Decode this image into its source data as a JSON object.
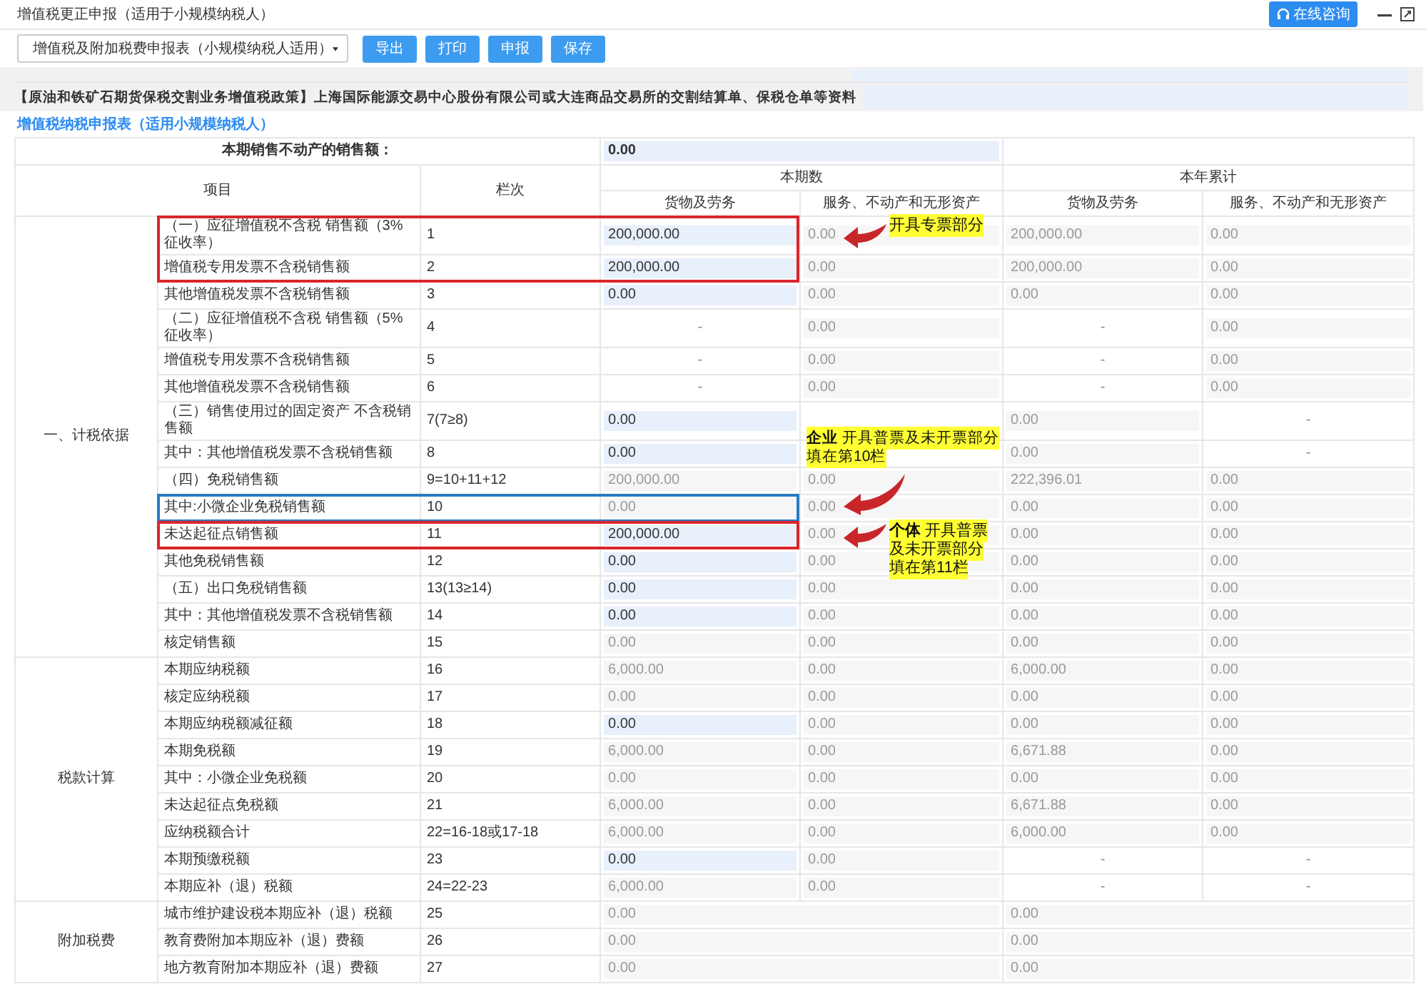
{
  "window": {
    "title": "增值税更正申报（适用于小规模纳税人）",
    "help_button": "在线咨询"
  },
  "toolbar": {
    "report_select": "增值税及附加税费申报表（小规模纳税人适用）",
    "buttons": [
      "导出",
      "打印",
      "申报",
      "保存"
    ]
  },
  "policy_note": "【原油和铁矿石期货保税交割业务增值税政策】上海国际能源交易中心股份有限公司或大连商品交易所的交割结算单、保税仓单等资料",
  "form_title": "增值税纳税申报表（适用小规模纳税人）",
  "table": {
    "real_estate_label": "本期销售不动产的销售额：",
    "real_estate_value": "0.00",
    "headers": {
      "item": "项目",
      "line": "栏次",
      "current": "本期数",
      "year": "本年累计",
      "sub": [
        "货物及劳务",
        "服务、不动产和无形资产",
        "货物及劳务",
        "服务、不动产和无形资产"
      ]
    },
    "groups": [
      {
        "label": "一、计税依据",
        "rows": [
          {
            "item": "（一）应征增值税不含税 销售额（3% 征收率）",
            "line": "1",
            "color": "#d9262c",
            "cells": [
              {
                "kind": "input",
                "value": "200,000.00"
              },
              {
                "kind": "readonly",
                "value": "0.00"
              },
              {
                "kind": "readonly",
                "value": "200,000.00"
              },
              {
                "kind": "readonly",
                "value": "0.00"
              }
            ],
            "note": {
              "kind": "beside",
              "lines": [
                "开具专票部分"
              ]
            }
          },
          {
            "item": "增值税专用发票不含税销售额",
            "line": "2",
            "color": "#d9262c",
            "cells": [
              {
                "kind": "input",
                "value": "200,000.00"
              },
              {
                "kind": "readonly",
                "value": "0.00"
              },
              {
                "kind": "readonly",
                "value": "200,000.00"
              },
              {
                "kind": "readonly",
                "value": "0.00"
              }
            ]
          },
          {
            "item": "其他增值税发票不含税销售额",
            "line": "3",
            "cells": [
              {
                "kind": "input",
                "value": "0.00"
              },
              {
                "kind": "readonly",
                "value": "0.00"
              },
              {
                "kind": "readonly",
                "value": "0.00"
              },
              {
                "kind": "readonly",
                "value": "0.00"
              }
            ]
          },
          {
            "item": "（二）应征增值税不含税 销售额（5%征收率）",
            "line": "4",
            "cells": [
              {
                "kind": "dash",
                "value": "-"
              },
              {
                "kind": "readonly",
                "value": "0.00"
              },
              {
                "kind": "dash",
                "value": "-"
              },
              {
                "kind": "readonly",
                "value": "0.00"
              }
            ]
          },
          {
            "item": "增值税专用发票不含税销售额",
            "line": "5",
            "cells": [
              {
                "kind": "dash",
                "value": "-"
              },
              {
                "kind": "readonly",
                "value": "0.00"
              },
              {
                "kind": "dash",
                "value": "-"
              },
              {
                "kind": "readonly",
                "value": "0.00"
              }
            ]
          },
          {
            "item": "其他增值税发票不含税销售额",
            "line": "6",
            "cells": [
              {
                "kind": "dash",
                "value": "-"
              },
              {
                "kind": "readonly",
                "value": "0.00"
              },
              {
                "kind": "dash",
                "value": "-"
              },
              {
                "kind": "readonly",
                "value": "0.00"
              }
            ]
          },
          {
            "item": "（三）销售使用过的固定资产 不含税销售额",
            "line": "7(7≥8)",
            "cells": [
              {
                "kind": "input",
                "value": "0.00"
              },
              {
                "kind": "blank"
              },
              {
                "kind": "readonly",
                "value": "0.00"
              },
              {
                "kind": "dash",
                "value": "-"
              }
            ]
          },
          {
            "item": "其中：其他增值税发票不含税销售额",
            "line": "8",
            "cells": [
              {
                "kind": "input",
                "value": "0.00"
              },
              {
                "kind": "blank"
              },
              {
                "kind": "readonly",
                "value": "0.00"
              },
              {
                "kind": "dash",
                "value": "-"
              }
            ]
          },
          {
            "item": "（四）免税销售额",
            "line": "9=10+11+12",
            "cells": [
              {
                "kind": "readonly",
                "value": "200,000.00"
              },
              {
                "kind": "readonly",
                "value": "0.00"
              },
              {
                "kind": "readonly",
                "value": "222,396.01"
              },
              {
                "kind": "readonly",
                "value": "0.00"
              }
            ]
          },
          {
            "item": "其中:小微企业免税销售额",
            "line": "10",
            "color": "#2a7bc4",
            "cells": [
              {
                "kind": "readonly",
                "value": "0.00"
              },
              {
                "kind": "readonly",
                "value": "0.00"
              },
              {
                "kind": "readonly",
                "value": "0.00"
              },
              {
                "kind": "readonly",
                "value": "0.00"
              }
            ],
            "note": {
              "kind": "above",
              "lines": [
                "**企业** 开具普票及未开票部分",
                "填在第10栏"
              ]
            }
          },
          {
            "item": "未达起征点销售额",
            "line": "11",
            "color": "#d9262c",
            "cells": [
              {
                "kind": "input",
                "value": "200,000.00"
              },
              {
                "kind": "readonly",
                "value": "0.00"
              },
              {
                "kind": "readonly",
                "value": "0.00"
              },
              {
                "kind": "readonly",
                "value": "0.00"
              }
            ],
            "note": {
              "kind": "beside",
              "lines": [
                "**个体** 开具普票及未开票部分",
                "填在第11栏"
              ]
            }
          },
          {
            "item": "其他免税销售额",
            "line": "12",
            "cells": [
              {
                "kind": "input",
                "value": "0.00"
              },
              {
                "kind": "readonly",
                "value": "0.00"
              },
              {
                "kind": "readonly",
                "value": "0.00"
              },
              {
                "kind": "readonly",
                "value": "0.00"
              }
            ]
          },
          {
            "item": "（五）出口免税销售额",
            "line": "13(13≥14)",
            "cells": [
              {
                "kind": "input",
                "value": "0.00"
              },
              {
                "kind": "readonly",
                "value": "0.00"
              },
              {
                "kind": "readonly",
                "value": "0.00"
              },
              {
                "kind": "readonly",
                "value": "0.00"
              }
            ]
          },
          {
            "item": "其中：其他增值税发票不含税销售额",
            "line": "14",
            "cells": [
              {
                "kind": "input",
                "value": "0.00"
              },
              {
                "kind": "readonly",
                "value": "0.00"
              },
              {
                "kind": "readonly",
                "value": "0.00"
              },
              {
                "kind": "readonly",
                "value": "0.00"
              }
            ]
          },
          {
            "item": "核定销售额",
            "line": "15",
            "cells": [
              {
                "kind": "readonly",
                "value": "0.00"
              },
              {
                "kind": "readonly",
                "value": "0.00"
              },
              {
                "kind": "readonly",
                "value": "0.00"
              },
              {
                "kind": "readonly",
                "value": "0.00"
              }
            ]
          }
        ]
      },
      {
        "label": "税款计算",
        "rows": [
          {
            "item": "本期应纳税额",
            "line": "16",
            "cells": [
              {
                "kind": "readonly",
                "value": "6,000.00"
              },
              {
                "kind": "readonly",
                "value": "0.00"
              },
              {
                "kind": "readonly",
                "value": "6,000.00"
              },
              {
                "kind": "readonly",
                "value": "0.00"
              }
            ]
          },
          {
            "item": "核定应纳税额",
            "line": "17",
            "cells": [
              {
                "kind": "readonly",
                "value": "0.00"
              },
              {
                "kind": "readonly",
                "value": "0.00"
              },
              {
                "kind": "readonly",
                "value": "0.00"
              },
              {
                "kind": "readonly",
                "value": "0.00"
              }
            ]
          },
          {
            "item": "本期应纳税额减征额",
            "line": "18",
            "cells": [
              {
                "kind": "input",
                "value": "0.00"
              },
              {
                "kind": "readonly",
                "value": "0.00"
              },
              {
                "kind": "readonly",
                "value": "0.00"
              },
              {
                "kind": "readonly",
                "value": "0.00"
              }
            ]
          },
          {
            "item": "本期免税额",
            "line": "19",
            "cells": [
              {
                "kind": "readonly",
                "value": "6,000.00"
              },
              {
                "kind": "readonly",
                "value": "0.00"
              },
              {
                "kind": "readonly",
                "value": "6,671.88"
              },
              {
                "kind": "readonly",
                "value": "0.00"
              }
            ]
          },
          {
            "item": "其中：小微企业免税额",
            "line": "20",
            "cells": [
              {
                "kind": "readonly",
                "value": "0.00"
              },
              {
                "kind": "readonly",
                "value": "0.00"
              },
              {
                "kind": "readonly",
                "value": "0.00"
              },
              {
                "kind": "readonly",
                "value": "0.00"
              }
            ]
          },
          {
            "item": "未达起征点免税额",
            "line": "21",
            "cells": [
              {
                "kind": "readonly",
                "value": "6,000.00"
              },
              {
                "kind": "readonly",
                "value": "0.00"
              },
              {
                "kind": "readonly",
                "value": "6,671.88"
              },
              {
                "kind": "readonly",
                "value": "0.00"
              }
            ]
          },
          {
            "item": "应纳税额合计",
            "line": "22=16-18或17-18",
            "cells": [
              {
                "kind": "readonly",
                "value": "6,000.00"
              },
              {
                "kind": "readonly",
                "value": "0.00"
              },
              {
                "kind": "readonly",
                "value": "6,000.00"
              },
              {
                "kind": "readonly",
                "value": "0.00"
              }
            ]
          },
          {
            "item": "本期预缴税额",
            "line": "23",
            "cells": [
              {
                "kind": "input",
                "value": "0.00"
              },
              {
                "kind": "readonly",
                "value": "0.00"
              },
              {
                "kind": "dash",
                "value": "-"
              },
              {
                "kind": "dash",
                "value": "-"
              }
            ]
          },
          {
            "item": "本期应补（退）税额",
            "line": "24=22-23",
            "cells": [
              {
                "kind": "readonly",
                "value": "6,000.00"
              },
              {
                "kind": "readonly",
                "value": "0.00"
              },
              {
                "kind": "dash",
                "value": "-"
              },
              {
                "kind": "dash",
                "value": "-"
              }
            ]
          }
        ]
      },
      {
        "label": "附加税费",
        "rows": [
          {
            "item": "城市维护建设税本期应补（退）税额",
            "line": "25",
            "cells": [
              {
                "kind": "readonly",
                "value": "0.00"
              },
              {
                "kind": "readonly",
                "value": "0.00"
              }
            ]
          },
          {
            "item": "教育费附加本期应补（退）费额",
            "line": "26",
            "cells": [
              {
                "kind": "readonly",
                "value": "0.00"
              },
              {
                "kind": "readonly",
                "value": "0.00"
              }
            ]
          },
          {
            "item": "地方教育附加本期应补（退）费额",
            "line": "27",
            "cells": [
              {
                "kind": "readonly",
                "value": "0.00"
              },
              {
                "kind": "readonly",
                "value": "0.00"
              }
            ]
          }
        ]
      }
    ]
  }
}
